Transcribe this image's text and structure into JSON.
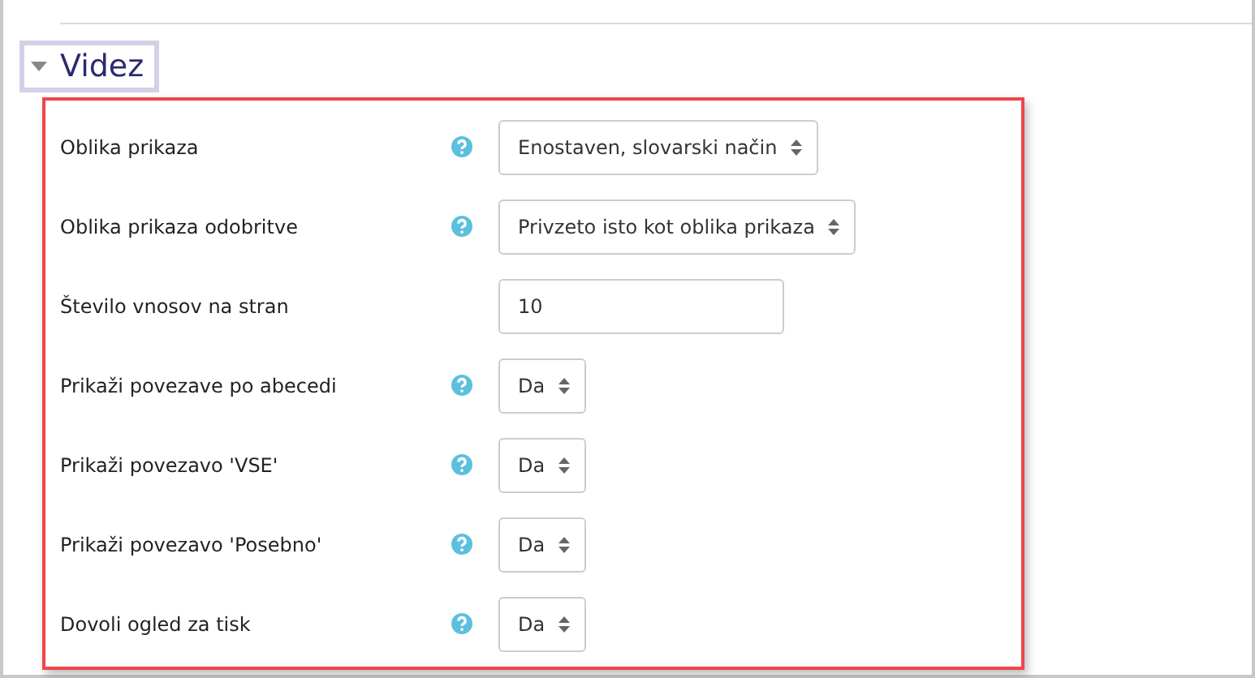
{
  "section": {
    "title": "Videz",
    "expanded": true
  },
  "fields": [
    {
      "label": "Oblika prikaza",
      "help": true,
      "kind": "select",
      "value": "Enostaven, slovarski način"
    },
    {
      "label": "Oblika prikaza odobritve",
      "help": true,
      "kind": "select",
      "value": "Privzeto isto kot oblika prikaza"
    },
    {
      "label": "Število vnosov na stran",
      "help": false,
      "kind": "text",
      "value": "10"
    },
    {
      "label": "Prikaži povezave po abecedi",
      "help": true,
      "kind": "select",
      "value": "Da"
    },
    {
      "label": "Prikaži povezavo 'VSE'",
      "help": true,
      "kind": "select",
      "value": "Da"
    },
    {
      "label": "Prikaži povezavo 'Posebno'",
      "help": true,
      "kind": "select",
      "value": "Da"
    },
    {
      "label": "Dovoli ogled za tisk",
      "help": true,
      "kind": "select",
      "value": "Da"
    }
  ]
}
